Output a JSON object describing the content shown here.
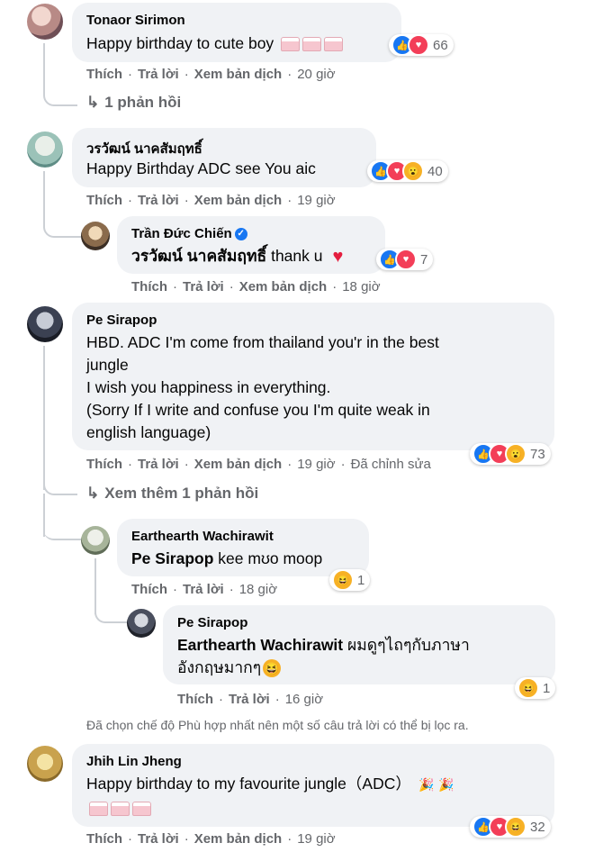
{
  "comments": [
    {
      "name": "Tonaor Sirimon",
      "text": "Happy birthday to cute boy",
      "reaction_count": "66",
      "time": "20 giờ"
    },
    {
      "name": "วรวัฒน์ นาคสัมฤทธิ์",
      "text": "Happy Birthday ADC see You aic",
      "reaction_count": "40",
      "time": "19 giờ"
    },
    {
      "name": "Pe Sirapop",
      "lines": [
        "HBD. ADC I'm come from thailand you'r in the best",
        "jungle",
        "I wish you happiness in everything.",
        "(Sorry If I write and confuse you I'm quite weak in",
        "english language)"
      ],
      "reaction_count": "73",
      "time": "19 giờ",
      "edited": "Đã chỉnh sửa"
    },
    {
      "name": "Jhih Lin Jheng",
      "text": "Happy birthday to my favourite jungle（ADC）",
      "reaction_count": "32",
      "time": "19 giờ"
    }
  ],
  "replies": [
    {
      "name": "Trần Đức Chiến",
      "tag": "วรวัฒน์ นาคสัมฤทธิ์",
      "text": " thank u",
      "reaction_count": "7",
      "time": "18 giờ"
    },
    {
      "name": "Earthearth Wachirawit",
      "tag": "Pe Sirapop",
      "text": " kee mʊo moop",
      "reaction_count": "1",
      "time": "18 giờ"
    },
    {
      "name": "Pe Sirapop",
      "tag": "Earthearth Wachirawit",
      "text": " ผมดูๆไถๆกับภาษา",
      "line2": "อังกฤษมากๆ",
      "reaction_count": "1",
      "time": "16 giờ"
    }
  ],
  "actions": {
    "like": "Thích",
    "reply": "Trả lời",
    "translate": "Xem bản dịch"
  },
  "more_links": {
    "one_reply": "1 phản hồi",
    "see_more": "Xem thêm 1 phản hồi"
  },
  "notice": "Đã chọn chế độ Phù hợp nhất nên một số câu trả lời có thể bị lọc ra.",
  "icons": {
    "reply_arrow": "↳",
    "like": "👍",
    "love": "♥",
    "wow": "😮",
    "haha": "😆",
    "verified": "✓"
  },
  "colors": {
    "bubble": "#f0f2f5",
    "like_blue": "#1877f2",
    "love_red": "#f33e58",
    "muted": "#65676b"
  }
}
